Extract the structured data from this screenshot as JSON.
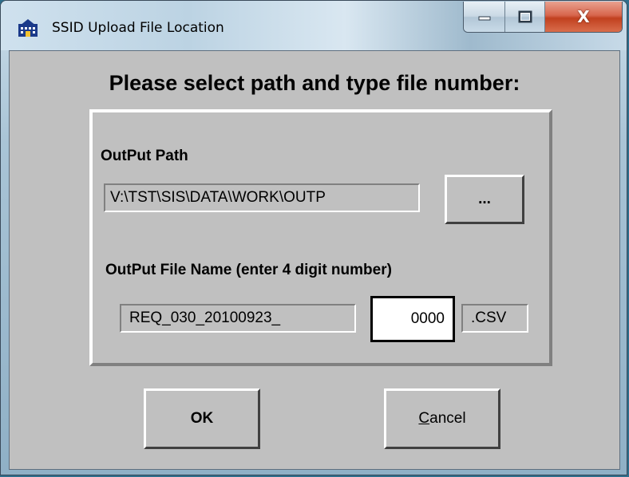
{
  "window": {
    "title": "SSID Upload File Location",
    "icon": "database-app-icon"
  },
  "caption_buttons": {
    "minimize_icon": "minimize-icon",
    "maximize_icon": "maximize-icon",
    "close_icon": "close-icon",
    "close_glyph": "X"
  },
  "dialog": {
    "heading": "Please select path and type file number:",
    "output_path": {
      "label": "OutPut Path",
      "value": "V:\\TST\\SIS\\DATA\\WORK\\OUTP",
      "browse_label": "..."
    },
    "output_file": {
      "label": "OutPut File Name (enter 4 digit number)",
      "prefix": "REQ_030_20100923_",
      "number": "0000",
      "extension": ".CSV"
    },
    "ok_label": "OK",
    "cancel_label_accel": "C",
    "cancel_label_rest": "ancel"
  },
  "colors": {
    "dialog_bg": "#c0c0c0",
    "close_button": "#c1401f"
  }
}
